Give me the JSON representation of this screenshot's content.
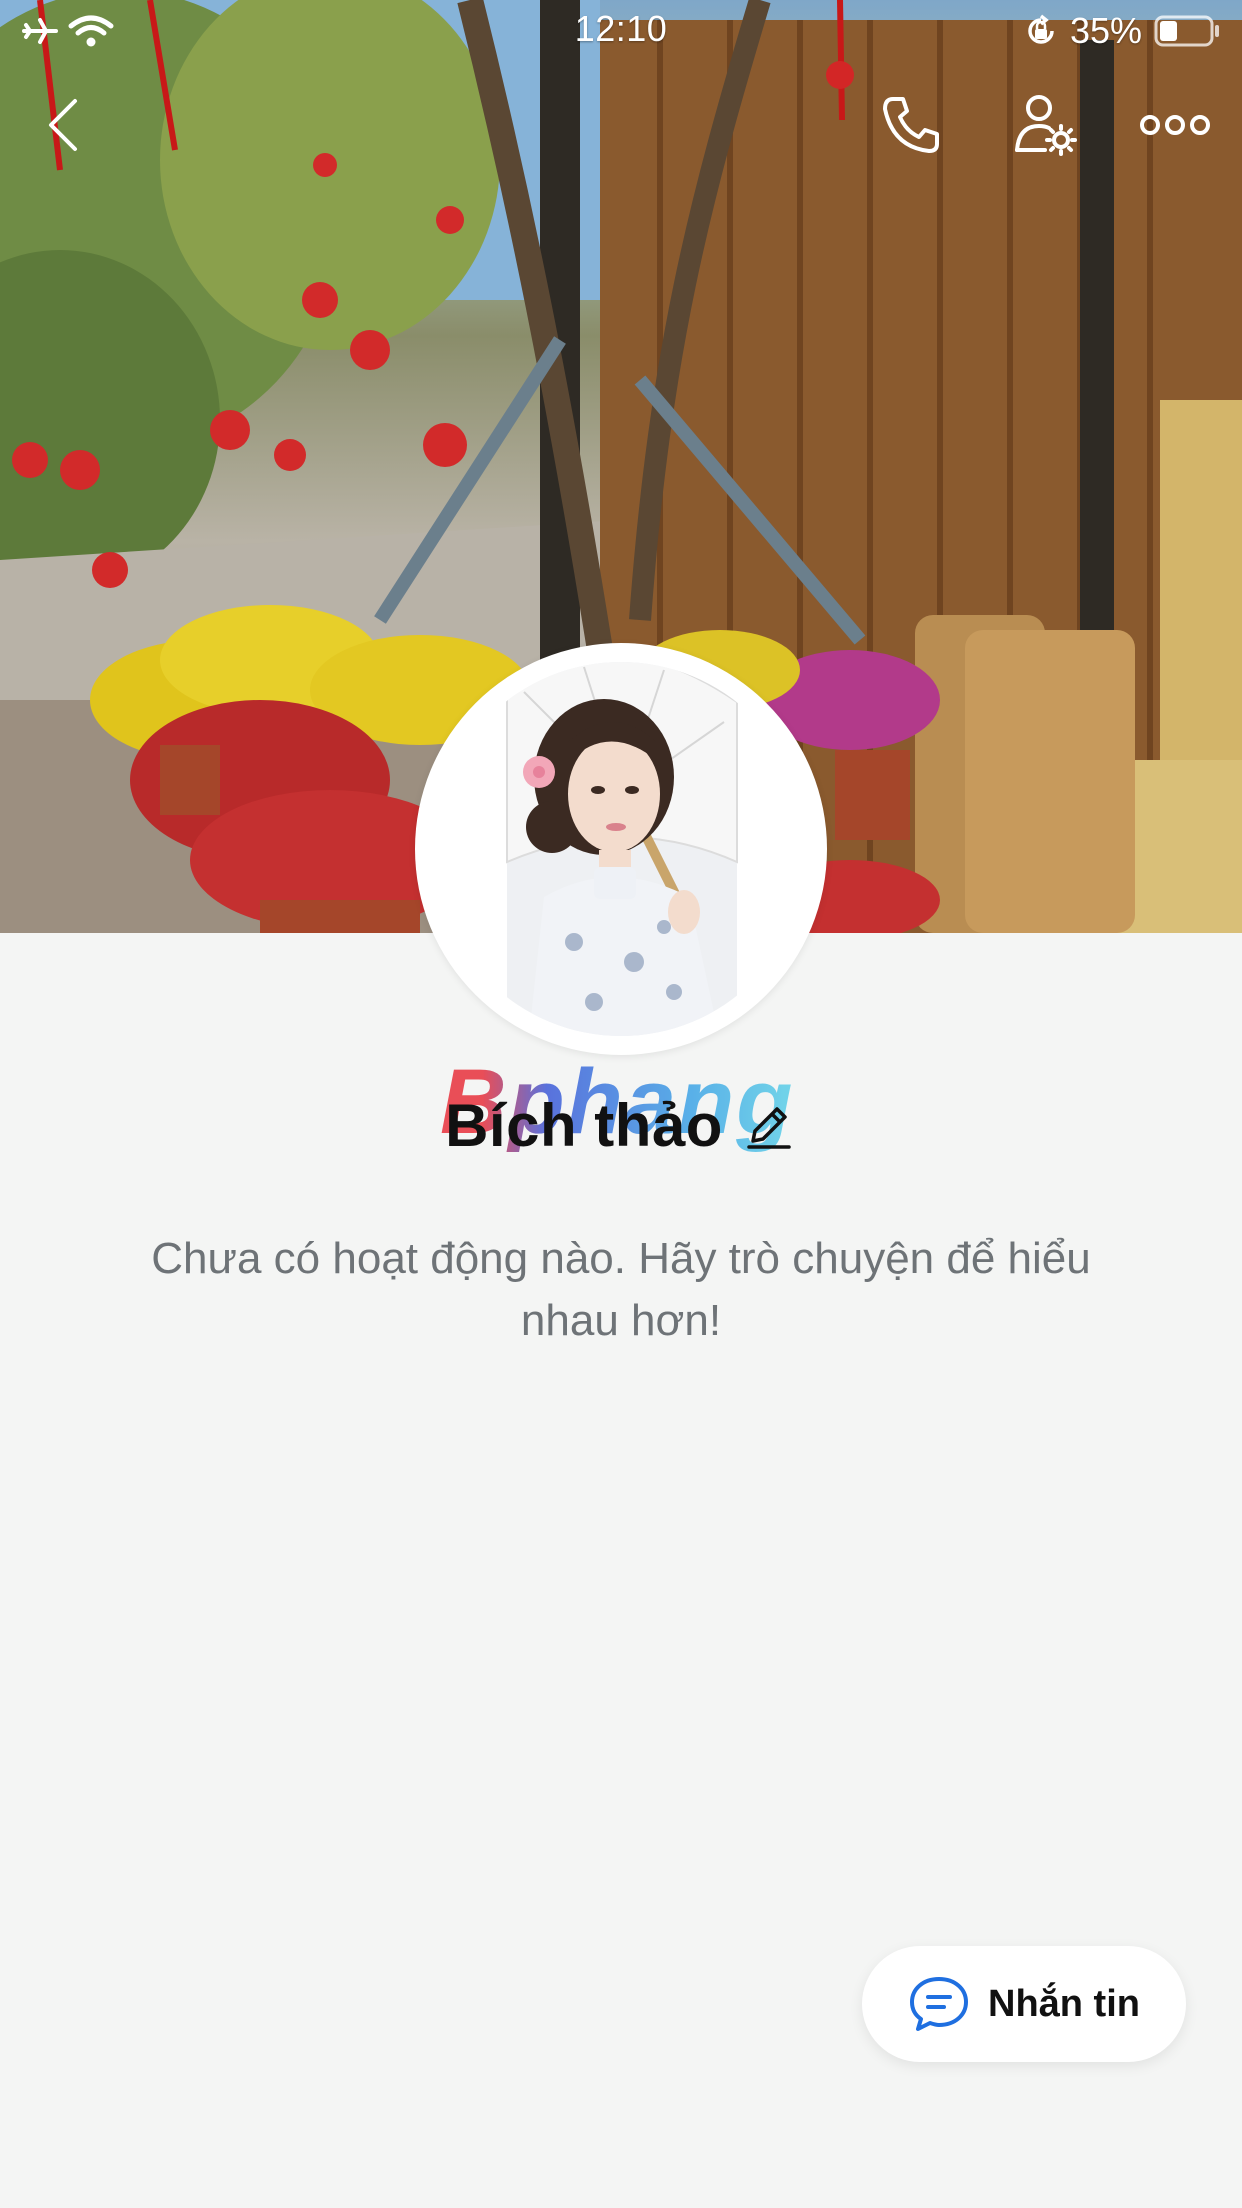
{
  "status_bar": {
    "time": "12:10",
    "battery_percent": "35%",
    "battery_level": 0.35
  },
  "nav": {
    "back_icon": "chevron-left-icon",
    "call_icon": "phone-icon",
    "user_settings_icon": "user-gear-icon",
    "more_icon": "more-dots-icon"
  },
  "profile": {
    "name": "Bích thảo",
    "edit_icon": "pencil-icon",
    "watermark": "Bphang"
  },
  "activity": {
    "empty_message": "Chưa có hoạt động nào. Hãy trò chuyện để hiểu nhau hơn!"
  },
  "message_button": {
    "label": "Nhắn tin",
    "icon": "chat-bubble-icon"
  },
  "colors": {
    "page_background": "#f4f5f4",
    "chat_icon_blue": "#1f6fe0",
    "muted_text": "#6e7377"
  }
}
